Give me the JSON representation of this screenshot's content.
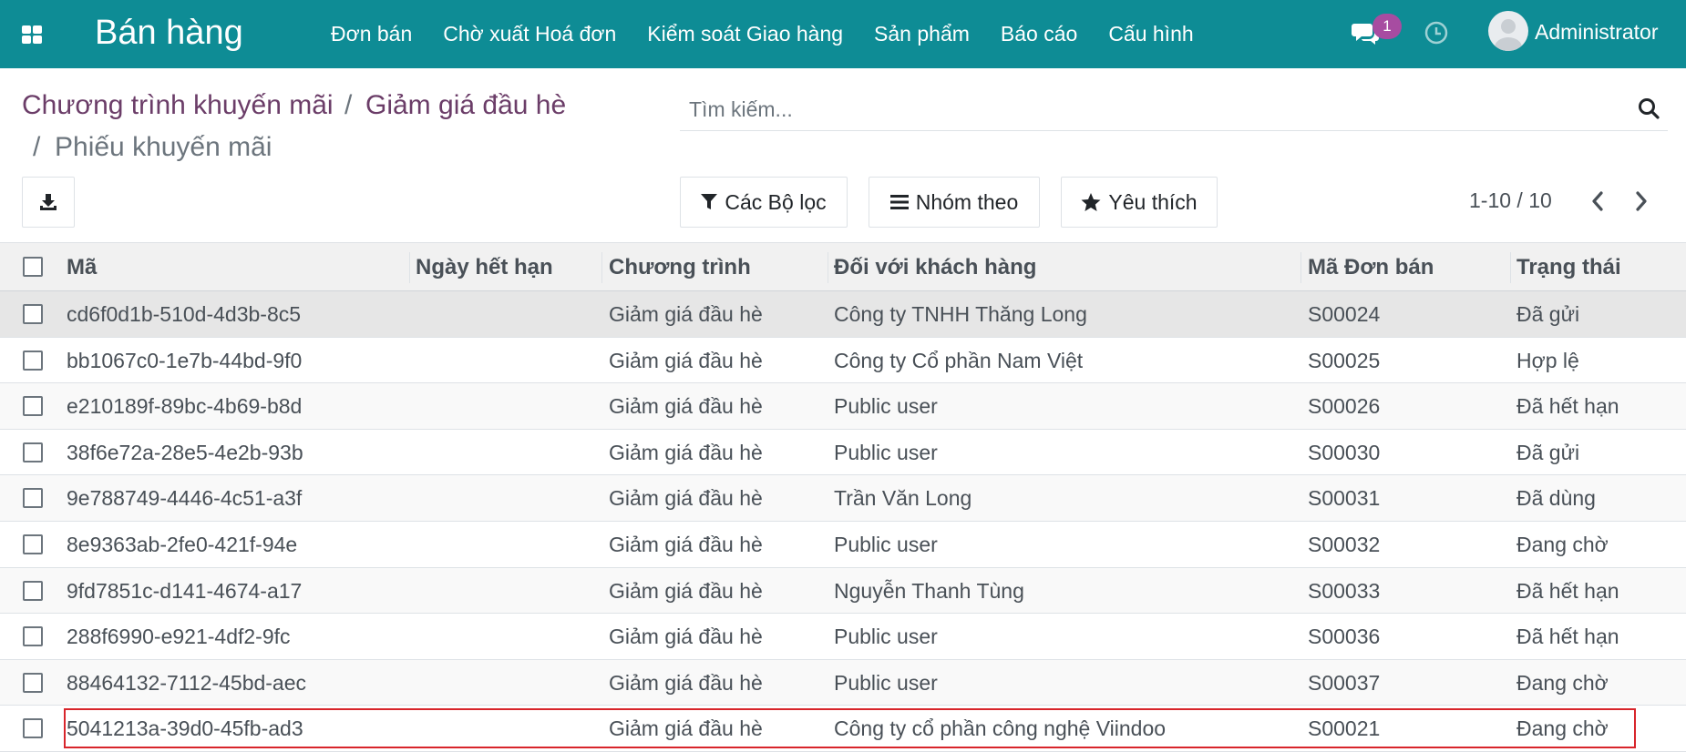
{
  "navbar": {
    "app_title": "Bán hàng",
    "menu": [
      "Đơn bán",
      "Chờ xuất Hoá đơn",
      "Kiểm soát Giao hàng",
      "Sản phẩm",
      "Báo cáo",
      "Cấu hình"
    ],
    "messages_count": "1",
    "user_name": "Administrator",
    "accent_color": "#0e8c95"
  },
  "breadcrumb": {
    "items": [
      "Chương trình khuyến mãi",
      "Giảm giá đầu hè"
    ],
    "separator": "/",
    "current": "Phiếu khuyến mãi"
  },
  "search": {
    "placeholder": "Tìm kiếm..."
  },
  "toolbar": {
    "filters_label": "Các Bộ lọc",
    "group_by_label": "Nhóm theo",
    "favorites_label": "Yêu thích"
  },
  "pager": {
    "value": "1-10 / 10"
  },
  "table": {
    "columns": [
      "Mã",
      "Ngày hết hạn",
      "Chương trình",
      "Đối với khách hàng",
      "Mã Đơn bán",
      "Trạng thái"
    ],
    "rows": [
      {
        "code": "cd6f0d1b-510d-4d3b-8c5",
        "expiry": "",
        "program": "Giảm giá đầu hè",
        "customer": "Công ty TNHH Thăng Long",
        "order": "S00024",
        "status": "Đã gửi"
      },
      {
        "code": "bb1067c0-1e7b-44bd-9f0",
        "expiry": "",
        "program": "Giảm giá đầu hè",
        "customer": "Công ty Cổ phần Nam Việt",
        "order": "S00025",
        "status": "Hợp lệ"
      },
      {
        "code": "e210189f-89bc-4b69-b8d",
        "expiry": "",
        "program": "Giảm giá đầu hè",
        "customer": "Public user",
        "order": "S00026",
        "status": "Đã hết hạn"
      },
      {
        "code": "38f6e72a-28e5-4e2b-93b",
        "expiry": "",
        "program": "Giảm giá đầu hè",
        "customer": "Public user",
        "order": "S00030",
        "status": "Đã gửi"
      },
      {
        "code": "9e788749-4446-4c51-a3f",
        "expiry": "",
        "program": "Giảm giá đầu hè",
        "customer": "Trần Văn Long",
        "order": "S00031",
        "status": "Đã dùng"
      },
      {
        "code": "8e9363ab-2fe0-421f-94e",
        "expiry": "",
        "program": "Giảm giá đầu hè",
        "customer": "Public user",
        "order": "S00032",
        "status": "Đang chờ"
      },
      {
        "code": "9fd7851c-d141-4674-a17",
        "expiry": "",
        "program": "Giảm giá đầu hè",
        "customer": "Nguyễn Thanh Tùng",
        "order": "S00033",
        "status": "Đã hết hạn"
      },
      {
        "code": "288f6990-e921-4df2-9fc",
        "expiry": "",
        "program": "Giảm giá đầu hè",
        "customer": "Public user",
        "order": "S00036",
        "status": "Đã hết hạn"
      },
      {
        "code": "88464132-7112-45bd-aec",
        "expiry": "",
        "program": "Giảm giá đầu hè",
        "customer": "Public user",
        "order": "S00037",
        "status": "Đang chờ"
      },
      {
        "code": "5041213a-39d0-45fb-ad3",
        "expiry": "",
        "program": "Giảm giá đầu hè",
        "customer": "Công ty cổ phần công nghệ Viindoo",
        "order": "S00021",
        "status": "Đang chờ"
      }
    ]
  },
  "icons": {
    "apps": "apps-grid-icon",
    "chat": "chat-icon",
    "activity": "clock-icon",
    "download": "download-icon",
    "filter": "filter-icon",
    "group": "bars-icon",
    "favorite": "star-icon",
    "search": "search-icon",
    "prev": "chevron-left-icon",
    "next": "chevron-right-icon"
  },
  "highlight_color": "#d8252b"
}
